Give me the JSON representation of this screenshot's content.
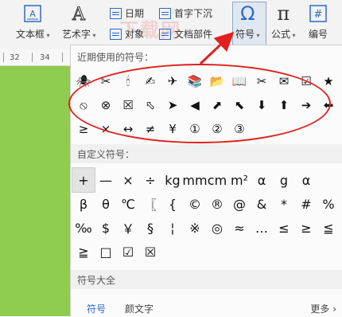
{
  "ribbon": {
    "textbox": "文本框",
    "wordart": "艺术字",
    "date": "日期",
    "dropcap": "首字下沉",
    "object": "对象",
    "docparts": "文档部件",
    "symbol": "符号",
    "formula": "公式",
    "number": "编号",
    "watermark": "下载网"
  },
  "ruler": {
    "left": "32",
    "right": "34"
  },
  "panel": {
    "recent_title": "近期使用的符号：",
    "recent_row1": [
      "🕷",
      "✂",
      "🕯",
      "✍",
      "✈",
      "📚",
      "📂",
      "📖",
      "✂",
      "✉",
      "☑",
      "★"
    ],
    "recent_row2": [
      "⦸",
      "⊗",
      "☒",
      "⬁",
      "➤",
      "◀",
      "⬈",
      "⬉",
      "⬇",
      "⬆",
      "➔",
      "⬅"
    ],
    "recent_row3": [
      "≥",
      "×",
      "↔",
      "≠",
      "¥",
      "①",
      "②",
      "③"
    ],
    "custom_title": "自定义符号：",
    "custom_row1": [
      "+",
      "—",
      "×",
      "÷",
      "kg",
      "mm",
      "cm",
      "m²",
      "α",
      "g",
      "α"
    ],
    "custom_row2": [
      "β",
      "θ",
      "℃",
      "〖",
      "{",
      "©",
      "®",
      "@",
      "&",
      "*",
      "#",
      "%"
    ],
    "custom_row3": [
      "‰",
      "$",
      "￥",
      "§",
      "¦",
      "※",
      "◎",
      "≈",
      "…",
      "≤",
      "≥",
      "≦"
    ],
    "custom_row4": [
      "≧",
      "□",
      "☑",
      "☒"
    ],
    "all_title": "符号大全",
    "tab_symbol": "符号",
    "tab_kaomoji": "颜文字",
    "more": "更多 ›"
  },
  "colors": {
    "accent": "#2d6ac7",
    "annotation": "#e02020",
    "document_bg": "#8fcc4f"
  }
}
